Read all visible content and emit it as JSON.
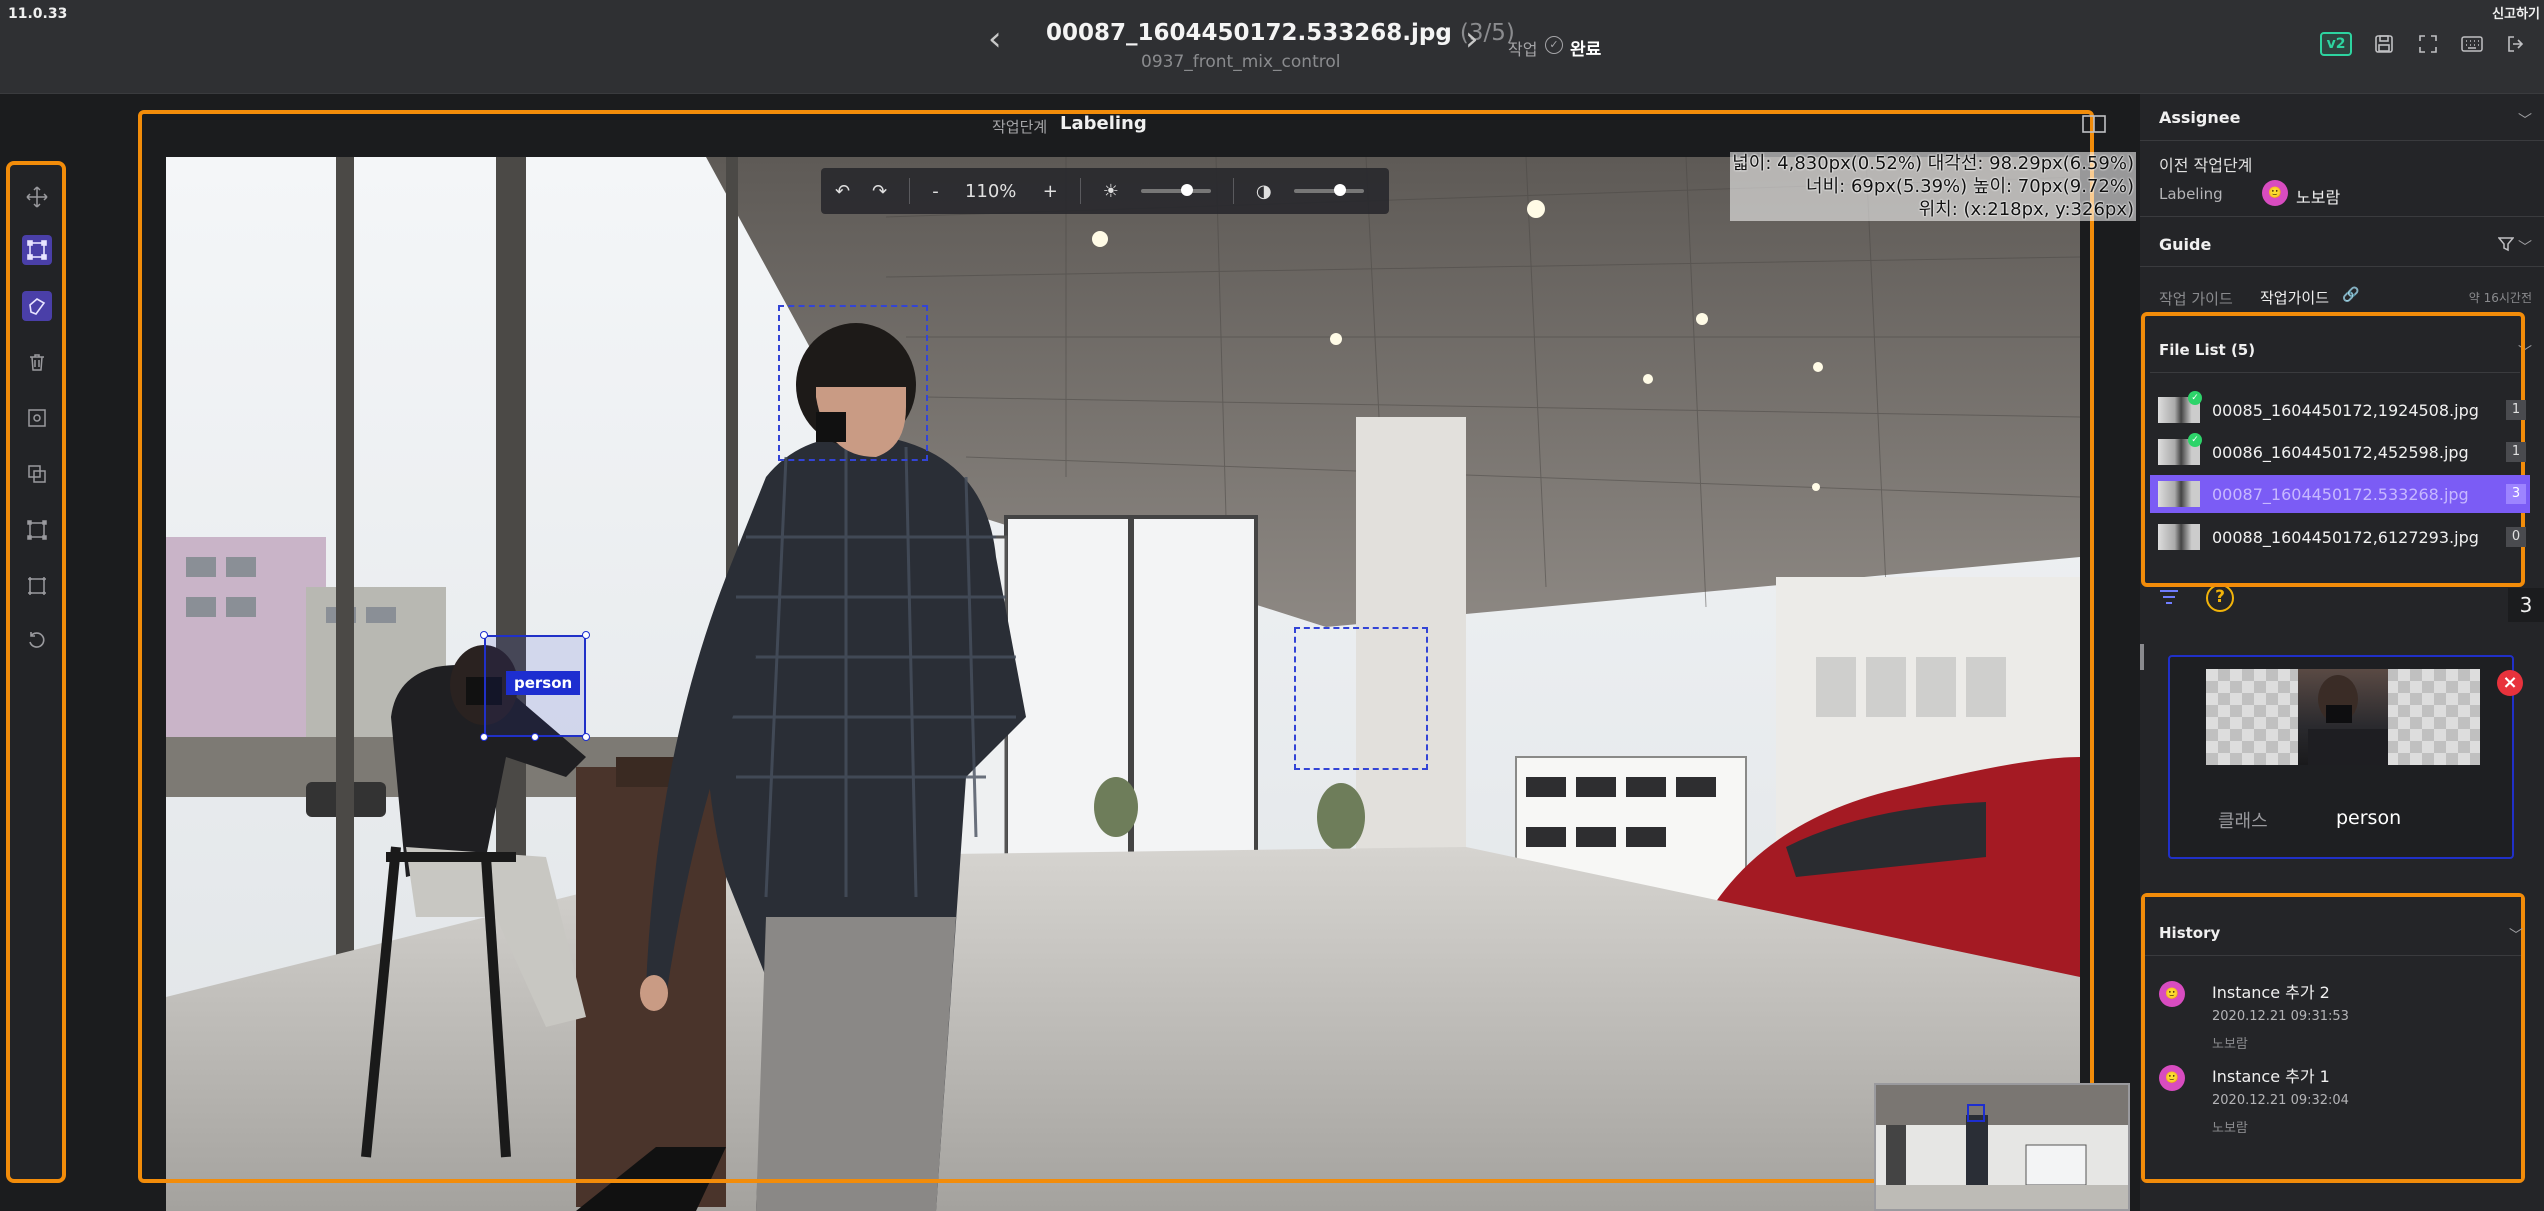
{
  "app": {
    "version": "11.0.33",
    "top_right": "신고하기"
  },
  "header": {
    "filename": "00087_1604450172.533268.jpg",
    "position": "(3/5)",
    "project": "0937_front_mix_control",
    "status_label": "작업",
    "status_value": "완료",
    "version_badge": "v2",
    "icons": [
      "v2-badge",
      "save-icon",
      "fullscreen-icon",
      "keyboard-icon",
      "logout-icon"
    ]
  },
  "canvas": {
    "stage_label": "작업단계",
    "stage_value": "Labeling",
    "zoom": "110%",
    "zoom_minus": "-",
    "zoom_plus": "+",
    "info_line1": "넓이: 4,830px(0.52%) 대각선: 98.29px(6.59%)",
    "info_line2": "너비: 69px(5.39%) 높이: 70px(9.72%)",
    "info_line3": "위치: (x:218px, y:326px)",
    "selected_label": "person"
  },
  "toolbar": {
    "tools": [
      "move-icon",
      "bbox-icon",
      "polygon-icon",
      "delete-icon",
      "focus-icon",
      "copy-icon",
      "crop-icon",
      "expand-icon",
      "reset-icon"
    ]
  },
  "sidebar": {
    "assignee_title": "Assignee",
    "prev_stage_title": "이전 작업단계",
    "prev_stage_name": "Labeling",
    "prev_stage_user": "노보람",
    "guide_title": "Guide",
    "guide_label": "작업 가이드",
    "guide_link": "작업가이드",
    "guide_time": "약 16시간전",
    "filelist_title": "File List (5)",
    "files": [
      {
        "name": "00085_1604450172,1924508.jpg",
        "count": "1",
        "done": true
      },
      {
        "name": "00086_1604450172,452598.jpg",
        "count": "1",
        "done": true
      },
      {
        "name": "00087_1604450172.533268.jpg",
        "count": "3",
        "done": false
      },
      {
        "name": "00088_1604450172,6127293.jpg",
        "count": "0",
        "done": false
      }
    ],
    "instance_count": "3",
    "instance_index": "0",
    "instance_class_key": "클래스",
    "instance_class_value": "person",
    "history_title": "History",
    "history": [
      {
        "title": "Instance 추가 2",
        "date": "2020.12.21 09:31:53",
        "user": "노보람"
      },
      {
        "title": "Instance 추가 1",
        "date": "2020.12.21 09:32:04",
        "user": "노보람"
      }
    ]
  },
  "colors": {
    "accent": "#7b5cf5",
    "highlight": "#f28c0a",
    "bbox": "#2030c8",
    "success": "#2dd46a"
  }
}
